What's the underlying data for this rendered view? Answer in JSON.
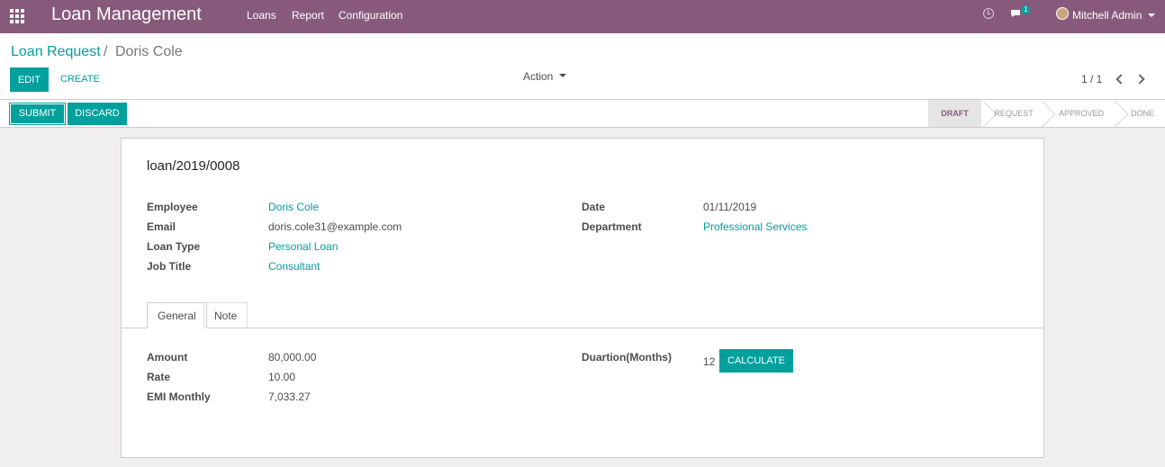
{
  "navbar": {
    "app_title": "Loan Management",
    "menu": [
      "Loans",
      "Report",
      "Configuration"
    ],
    "chat_count": "1",
    "user_name": "Mitchell Admin"
  },
  "control": {
    "breadcrumb_parent": "Loan Request",
    "breadcrumb_sep": "/",
    "breadcrumb_current": "Doris Cole",
    "edit_label": "EDIT",
    "create_label": "CREATE",
    "action_label": "Action",
    "pager": "1 / 1"
  },
  "statusbar": {
    "submit_label": "SUBMIT",
    "discard_label": "DISCARD",
    "stages": [
      "DRAFT",
      "REQUEST",
      "APPROVED",
      "DONE"
    ],
    "active_stage": "DRAFT"
  },
  "form": {
    "reference": "loan/2019/0008",
    "left": [
      {
        "label": "Employee",
        "value": "Doris Cole"
      },
      {
        "label": "Email",
        "value": "doris.cole31@example.com"
      },
      {
        "label": "Loan Type",
        "value": "Personal Loan"
      },
      {
        "label": "Job Title",
        "value": "Consultant"
      }
    ],
    "right": [
      {
        "label": "Date",
        "value": "01/11/2019"
      },
      {
        "label": "Department",
        "value": "Professional Services"
      }
    ],
    "tabs": [
      "General",
      "Note"
    ],
    "general": {
      "amount_label": "Amount",
      "amount": "80,000.00",
      "rate_label": "Rate",
      "rate": "10.00",
      "emi_label": "EMI Monthly",
      "emi": "7,033.27",
      "duration_label": "Duartion(Months)",
      "duration": "12",
      "calculate_label": "CALCULATE"
    }
  },
  "colors": {
    "brand": "#875a7b",
    "accent": "#00a09d"
  }
}
